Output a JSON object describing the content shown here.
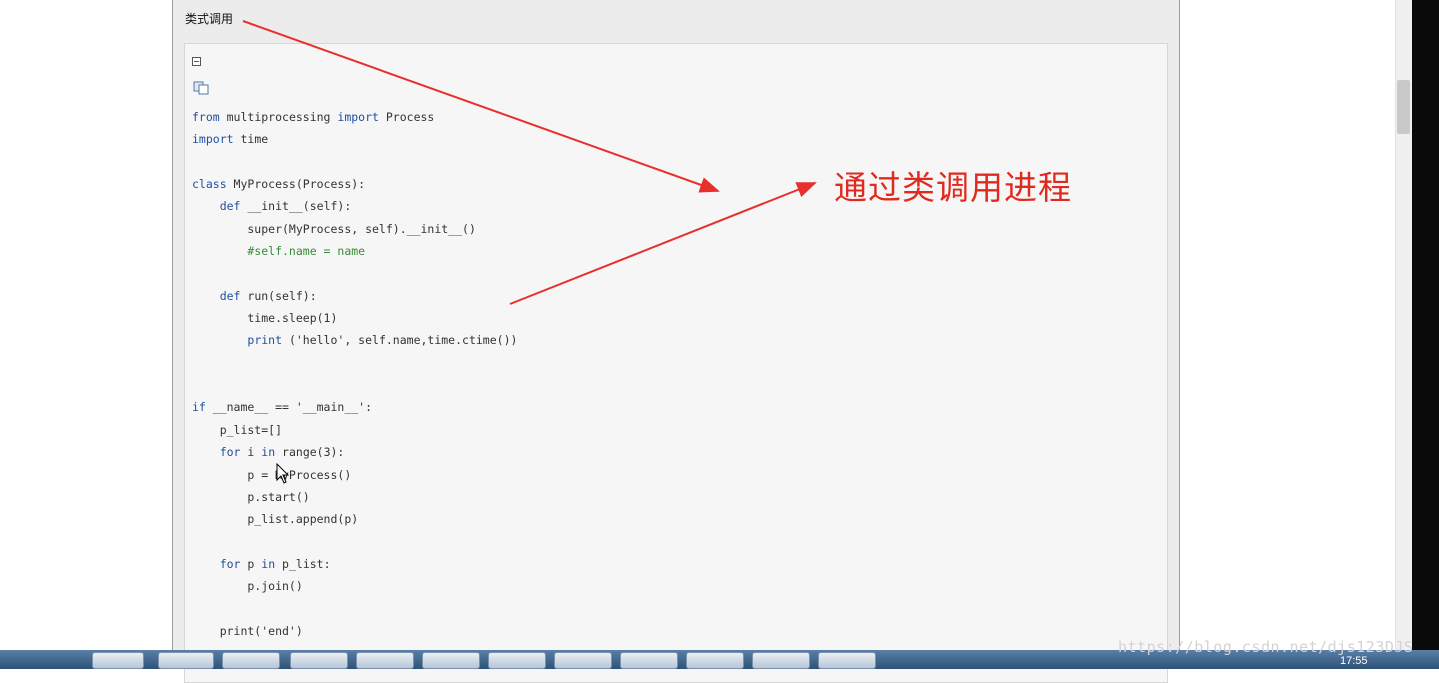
{
  "section_title": "类式调用",
  "annotation": "通过类调用进程",
  "code_lines": [
    [
      {
        "t": "from",
        "c": "kw"
      },
      {
        "t": " multiprocessing "
      },
      {
        "t": "import",
        "c": "kw"
      },
      {
        "t": " Process"
      }
    ],
    [
      {
        "t": "import",
        "c": "kw"
      },
      {
        "t": " time"
      }
    ],
    [],
    [
      {
        "t": "class",
        "c": "kw"
      },
      {
        "t": " MyProcess(Process):"
      }
    ],
    [
      {
        "t": "    "
      },
      {
        "t": "def",
        "c": "kw"
      },
      {
        "t": " __init__(self):"
      }
    ],
    [
      {
        "t": "        super(MyProcess, self).__init__()"
      }
    ],
    [
      {
        "t": "        "
      },
      {
        "t": "#self.name = name",
        "c": "cm"
      }
    ],
    [],
    [
      {
        "t": "    "
      },
      {
        "t": "def",
        "c": "kw"
      },
      {
        "t": " run(self):"
      }
    ],
    [
      {
        "t": "        time.sleep(1)"
      }
    ],
    [
      {
        "t": "        "
      },
      {
        "t": "print",
        "c": "kw"
      },
      {
        "t": " ('hello', self.name,time.ctime())"
      }
    ],
    [],
    [],
    [
      {
        "t": "if",
        "c": "kw"
      },
      {
        "t": " __name__ == '__main__':"
      }
    ],
    [
      {
        "t": "    p_list=[]"
      }
    ],
    [
      {
        "t": "    "
      },
      {
        "t": "for",
        "c": "kw"
      },
      {
        "t": " i "
      },
      {
        "t": "in",
        "c": "kw"
      },
      {
        "t": " range(3):"
      }
    ],
    [
      {
        "t": "        p = MyProcess()"
      }
    ],
    [
      {
        "t": "        p.start()"
      }
    ],
    [
      {
        "t": "        p_list.append(p)"
      }
    ],
    [],
    [
      {
        "t": "    "
      },
      {
        "t": "for",
        "c": "kw"
      },
      {
        "t": " p "
      },
      {
        "t": "in",
        "c": "kw"
      },
      {
        "t": " p_list:"
      }
    ],
    [
      {
        "t": "        p.join()"
      }
    ],
    [],
    [
      {
        "t": "    print('end')"
      }
    ]
  ],
  "watermark": "https://blog.csdn.net/djs123DJS",
  "clock": "17:55",
  "colors": {
    "keyword": "#1f4f9f",
    "comment": "#3a8a3a",
    "annotation": "#e02a1e"
  }
}
